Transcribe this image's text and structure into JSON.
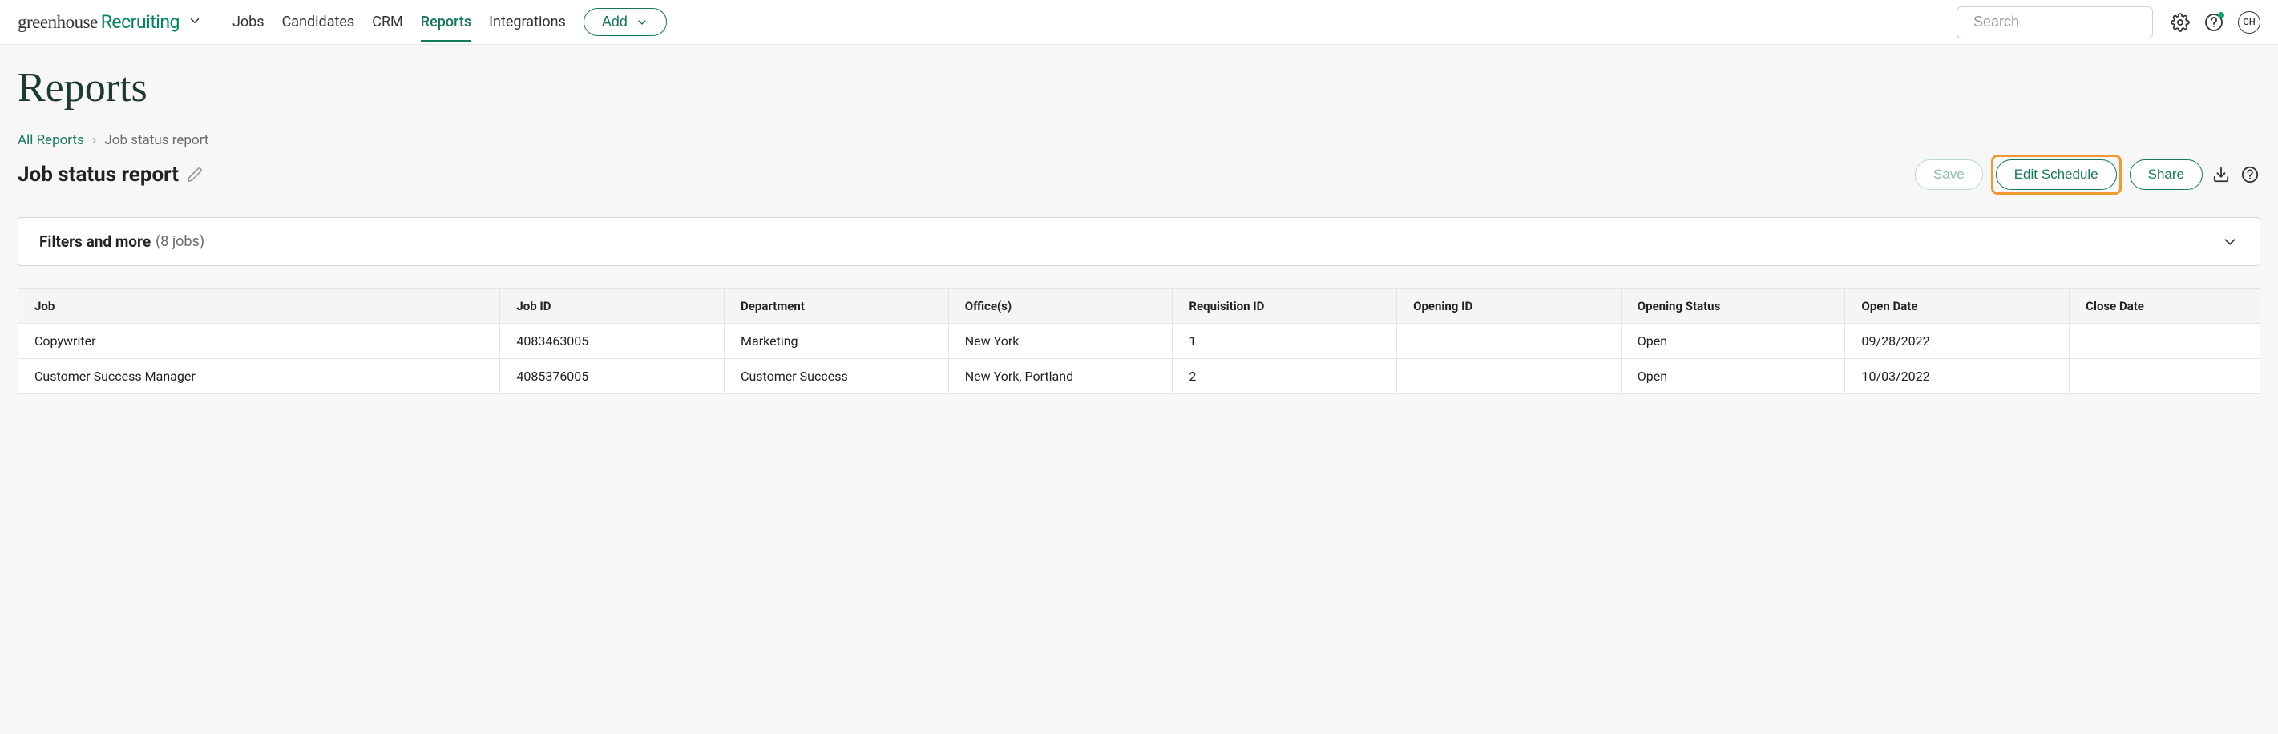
{
  "brand": {
    "word1": "greenhouse",
    "word2": "Recruiting"
  },
  "nav": {
    "items": [
      {
        "label": "Jobs"
      },
      {
        "label": "Candidates"
      },
      {
        "label": "CRM"
      },
      {
        "label": "Reports",
        "active": true
      },
      {
        "label": "Integrations"
      }
    ],
    "add_label": "Add"
  },
  "search": {
    "placeholder": "Search"
  },
  "avatar": {
    "initials": "GH"
  },
  "page": {
    "title": "Reports",
    "breadcrumb": {
      "root": "All Reports",
      "current": "Job status report"
    },
    "report_title": "Job status report",
    "actions": {
      "save": "Save",
      "edit_schedule": "Edit Schedule",
      "share": "Share"
    },
    "filters": {
      "label": "Filters and more",
      "count_text": "(8 jobs)"
    }
  },
  "table": {
    "columns": [
      "Job",
      "Job ID",
      "Department",
      "Office(s)",
      "Requisition ID",
      "Opening ID",
      "Opening Status",
      "Open Date",
      "Close Date"
    ],
    "rows": [
      {
        "job": "Copywriter",
        "job_id": "4083463005",
        "department": "Marketing",
        "offices": "New York",
        "requisition_id": "1",
        "opening_id": "",
        "opening_status": "Open",
        "open_date": "09/28/2022",
        "close_date": ""
      },
      {
        "job": "Customer Success Manager",
        "job_id": "4085376005",
        "department": "Customer Success",
        "offices": "New York, Portland",
        "requisition_id": "2",
        "opening_id": "",
        "opening_status": "Open",
        "open_date": "10/03/2022",
        "close_date": ""
      }
    ]
  }
}
